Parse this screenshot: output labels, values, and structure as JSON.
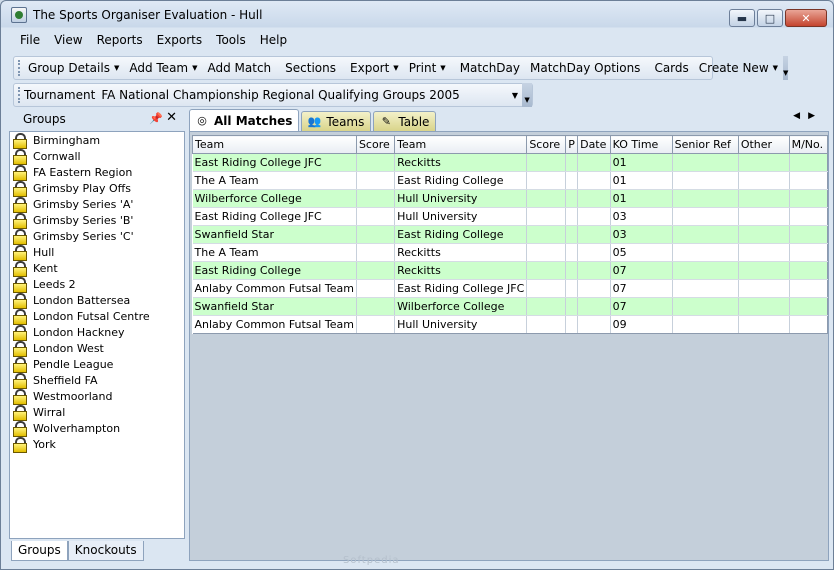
{
  "window": {
    "title": "The Sports Organiser Evaluation - Hull",
    "controls": {
      "minimize": "▬",
      "maximize": "□",
      "close": "✕"
    }
  },
  "menu": [
    "File",
    "View",
    "Reports",
    "Exports",
    "Tools",
    "Help"
  ],
  "toolbar": {
    "group_details": "Group Details",
    "add_team": "Add Team",
    "add_match": "Add Match",
    "sections": "Sections",
    "export": "Export",
    "print": "Print",
    "matchday": "MatchDay",
    "matchday_options": "MatchDay Options",
    "cards": "Cards",
    "create_new": "Create New"
  },
  "tournament": {
    "label": "Tournament",
    "value": "FA National Championship Regional Qualifying Groups 2005"
  },
  "groups_panel": {
    "title": "Groups",
    "items": [
      "Birmingham",
      "Cornwall",
      "FA Eastern Region",
      "Grimsby Play Offs",
      "Grimsby Series 'A'",
      "Grimsby Series 'B'",
      "Grimsby Series 'C'",
      "Hull",
      "Kent",
      "Leeds 2",
      "London Battersea",
      "London Futsal Centre",
      "London Hackney",
      "London West",
      "Pendle League",
      "Sheffield FA",
      "Westmoorland",
      "Wirral",
      "Wolverhampton",
      "York"
    ],
    "tabs": [
      "Groups",
      "Knockouts"
    ]
  },
  "main_tabs": [
    "All Matches",
    "Teams",
    "Table"
  ],
  "grid": {
    "columns": [
      "Team",
      "Score",
      "Team",
      "Score",
      "P",
      "Date",
      "KO Time",
      "Senior Ref",
      "Other",
      "M/No."
    ],
    "rows": [
      [
        "East Riding College JFC",
        "",
        "Reckitts",
        "",
        "",
        "",
        "01",
        "",
        "",
        ""
      ],
      [
        "The A Team",
        "",
        "East Riding College",
        "",
        "",
        "",
        "01",
        "",
        "",
        ""
      ],
      [
        "Wilberforce College",
        "",
        "Hull University",
        "",
        "",
        "",
        "01",
        "",
        "",
        ""
      ],
      [
        "East Riding College JFC",
        "",
        "Hull University",
        "",
        "",
        "",
        "03",
        "",
        "",
        ""
      ],
      [
        "Swanfield Star",
        "",
        "East Riding College",
        "",
        "",
        "",
        "03",
        "",
        "",
        ""
      ],
      [
        "The A Team",
        "",
        "Reckitts",
        "",
        "",
        "",
        "05",
        "",
        "",
        ""
      ],
      [
        "East Riding College",
        "",
        "Reckitts",
        "",
        "",
        "",
        "07",
        "",
        "",
        ""
      ],
      [
        "Anlaby Common Futsal Team",
        "",
        "East Riding College JFC",
        "",
        "",
        "",
        "07",
        "",
        "",
        ""
      ],
      [
        "Swanfield Star",
        "",
        "Wilberforce College",
        "",
        "",
        "",
        "07",
        "",
        "",
        ""
      ],
      [
        "Anlaby Common Futsal Team",
        "",
        "Hull University",
        "",
        "",
        "",
        "09",
        "",
        "",
        ""
      ]
    ]
  },
  "colors": {
    "row_highlight": "#ccffcc",
    "tab_yellow": "#d9d48a"
  }
}
